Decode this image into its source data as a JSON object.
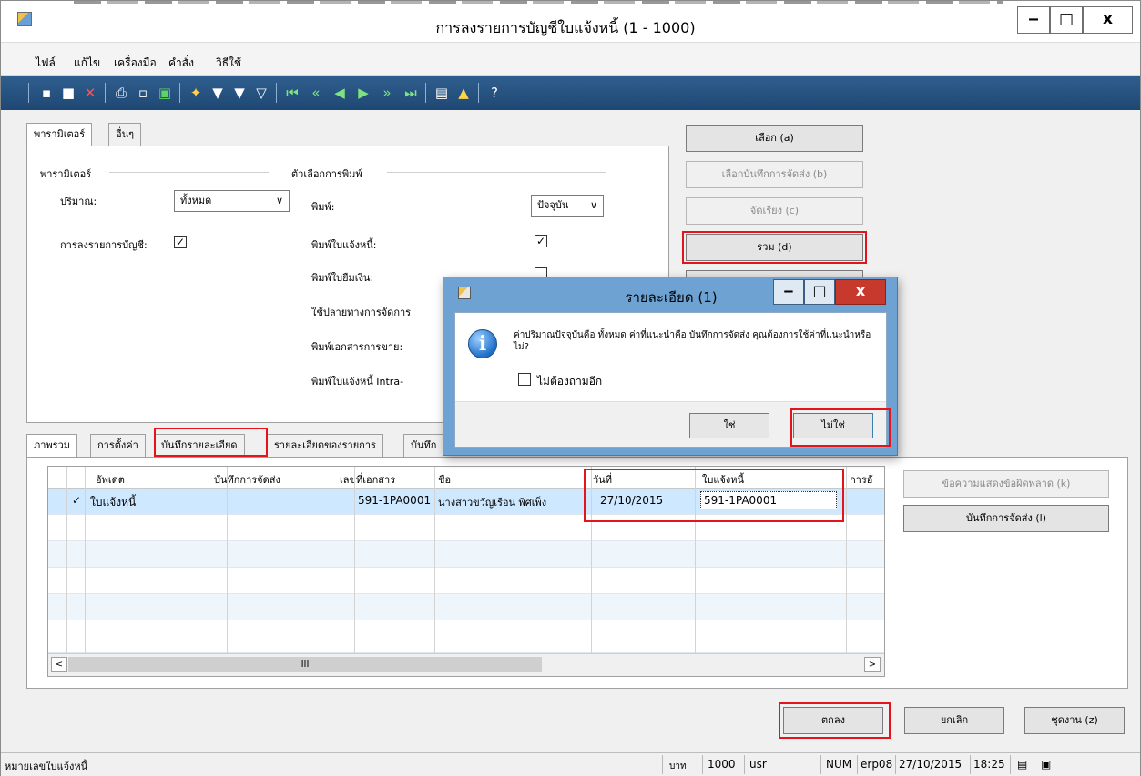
{
  "window": {
    "title": "การลงรายการบัญชีใบแจ้งหนี้ (1 - 1000)",
    "min_glyph": "‒",
    "max_glyph": "□",
    "close_glyph": "x"
  },
  "menu": [
    "ไฟล์",
    "แก้ไข",
    "เครื่องมือ",
    "คำสั่ง",
    "วิธีใช้"
  ],
  "tabs_top": [
    "พารามิเตอร์",
    "อื่นๆ"
  ],
  "params": {
    "group_title": "พารามิเตอร์",
    "quantity_label": "ปริมาณ:",
    "quantity_value": "ทั้งหมด",
    "posting_label": "การลงรายการบัญชี:"
  },
  "print_options": {
    "group_title": "ตัวเลือกการพิมพ์",
    "print_label": "พิมพ์:",
    "print_value": "ปัจจุบัน",
    "print_invoice_label": "พิมพ์ใบแจ้งหนี้:",
    "print_credit_label": "พิมพ์ใบยืมเงิน:",
    "use_destination_label": "ใช้ปลายทางการจัดการ",
    "print_sales_doc_label": "พิมพ์เอกสารการขาย:",
    "print_intra_label": "พิมพ์ใบแจ้งหนี้ Intra-"
  },
  "side_buttons": {
    "select": "เลือก (a)",
    "select_packing": "เลือกบันทึกการจัดส่ง (b)",
    "arrange": "จัดเรียง (c)",
    "summary": "รวม (d)"
  },
  "tabs_bottom": [
    "ภาพรวม",
    "การตั้งค่า",
    "บันทึกรายละเอียด",
    "รายละเอียดของรายการ",
    "บันทึก"
  ],
  "grid": {
    "headers": [
      "อัพเดต",
      "บันทึกการจัดส่ง",
      "เลขที่เอกสาร",
      "ชื่อ",
      "วันที่",
      "ใบแจ้งหนี้",
      "การอั"
    ],
    "rows": [
      {
        "check": "✓",
        "update": "ใบแจ้งหนี้",
        "packing": "",
        "doc": "591-1PA0001",
        "name": "นางสาวขวัญเรือน พิศเพ็ง",
        "date": "27/10/2015",
        "invoice": "591-1PA0001"
      }
    ],
    "scroll_thumb": "III"
  },
  "right_buttons": {
    "error_msg": "ข้อความแสดงข้อผิดพลาด (k)",
    "packing_slip": "บันทึกการจัดส่ง (l)"
  },
  "bottom_buttons": {
    "ok": "ตกลง",
    "cancel": "ยกเลิก",
    "batch": "ชุดงาน (z)"
  },
  "status": {
    "field": "หมายเลขใบแจ้งหนี้",
    "currency": "บาท",
    "company_count": "1000",
    "user": "usr",
    "num": "NUM",
    "server": "erp08",
    "date": "27/10/2015",
    "time": "18:25"
  },
  "dialog": {
    "title": "รายละเอียด (1)",
    "message": "ค่าปริมาณปัจจุบันคือ ทั้งหมด ค่าที่แนะนำคือ บันทึกการจัดส่ง คุณต้องการใช้ค่าที่แนะนำหรือไม่?",
    "dont_ask": "ไม่ต้องถามอีก",
    "yes": "ใช่",
    "no": "ไม่ใช่"
  },
  "colors": {
    "toolbar": "#1f4773",
    "highlight": "#e3151a",
    "dialog_frame": "#6ea2d2",
    "selected_row": "#cde8ff"
  }
}
